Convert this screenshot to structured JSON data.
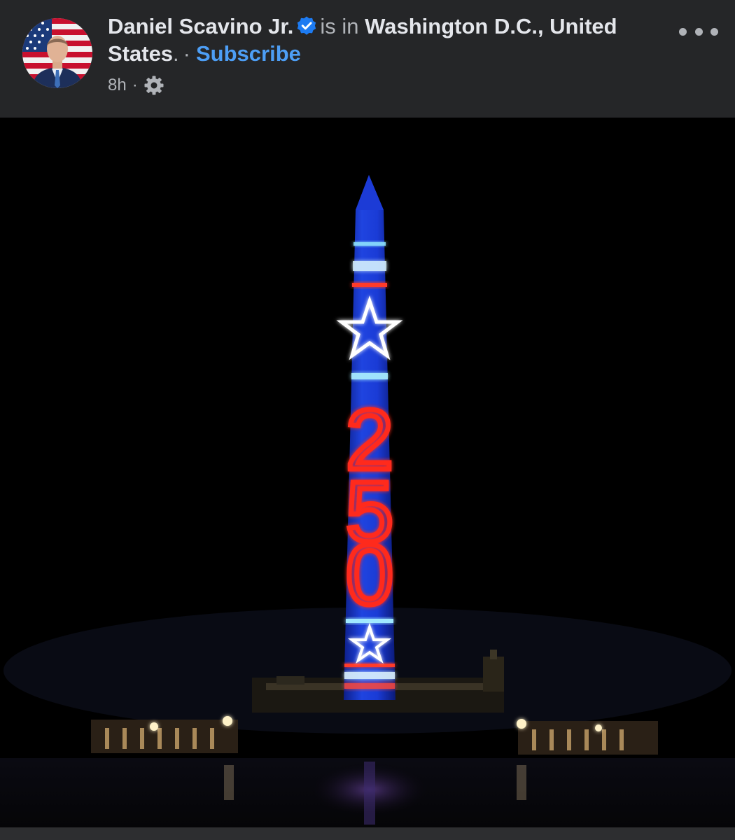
{
  "post": {
    "author_name": "Daniel Scavino Jr.",
    "verified": true,
    "location_prefix": "is in",
    "location": "Washington D.C., United States",
    "location_suffix": ".",
    "separator": "·",
    "subscribe_label": "Subscribe",
    "timestamp": "8h",
    "meta_separator": "·",
    "audience_icon": "gear-icon",
    "more_icon": "more-options-icon"
  },
  "photo": {
    "projection_number": "250",
    "projection_digits": [
      "2",
      "5",
      "0"
    ],
    "icons": [
      "star-icon",
      "star-icon"
    ]
  },
  "colors": {
    "background": "#252628",
    "text_primary": "#e4e6eb",
    "text_secondary": "#b0b3b8",
    "link": "#4d9ef5",
    "verified_badge": "#1d7bf2",
    "neon_red": "#ff2a1f",
    "projection_blue": "#1a3bd6"
  }
}
